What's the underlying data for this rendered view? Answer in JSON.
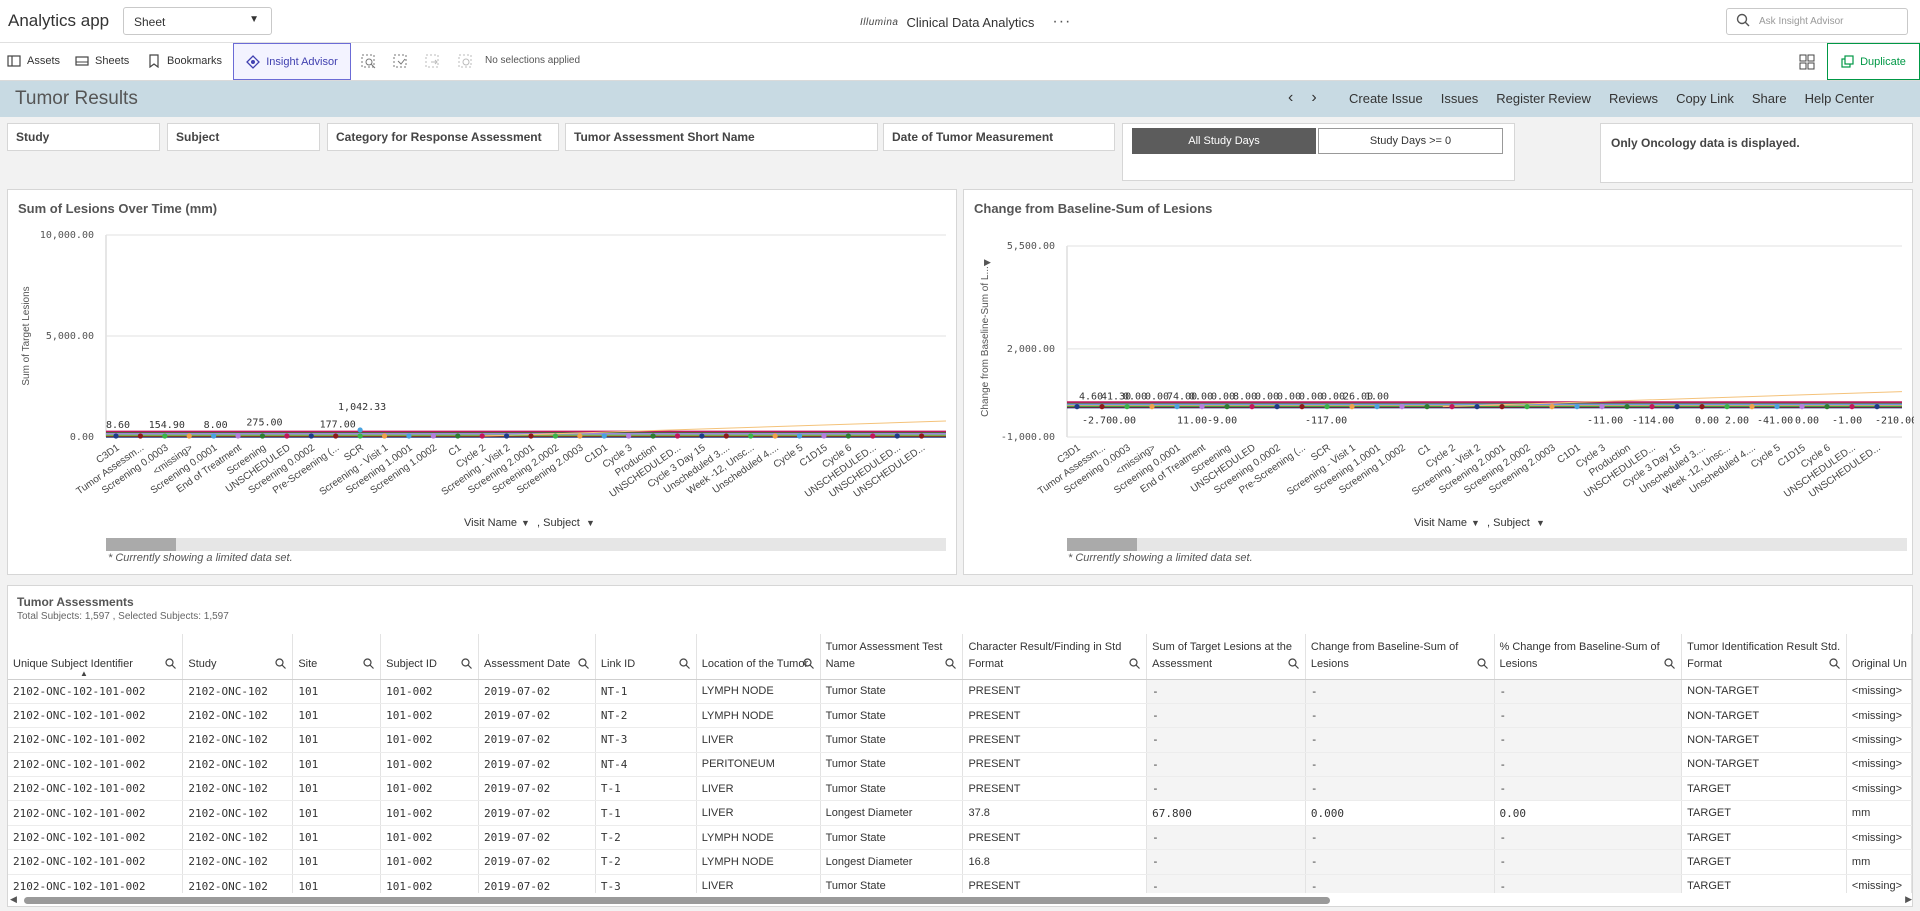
{
  "topbar": {
    "app_name": "Analytics app",
    "sheet_select": "Sheet",
    "brand_logo": "Illumina",
    "brand_title": "Clinical Data Analytics",
    "more": "···",
    "ask_placeholder": "Ask Insight Advisor"
  },
  "toolbar": {
    "assets": "Assets",
    "sheets": "Sheets",
    "bookmarks": "Bookmarks",
    "insight_advisor": "Insight Advisor",
    "no_selections": "No selections applied",
    "duplicate": "Duplicate"
  },
  "sheetbar": {
    "title": "Tumor Results",
    "prev": "‹",
    "next": "›",
    "links": [
      "Create Issue",
      "Issues",
      "Register Review",
      "Reviews",
      "Copy Link",
      "Share",
      "Help Center"
    ]
  },
  "filters": [
    "Study",
    "Subject",
    "Category for Response Assessment",
    "Tumor Assessment Short Name",
    "Date of Tumor Measurement"
  ],
  "days": {
    "all": "All Study Days",
    "ge0": "Study Days >= 0"
  },
  "note": "Only Oncology data is displayed.",
  "chart1": {
    "title": "Sum of Lesions Over Time (mm)",
    "dim1": "Visit Name",
    "dim2": ", Subject",
    "limited": "* Currently showing a limited data set."
  },
  "chart2": {
    "title": "Change from Baseline-Sum of Lesions",
    "dim1": "Visit Name",
    "dim2": ", Subject",
    "limited": "* Currently showing a limited data set."
  },
  "chart_data": [
    {
      "type": "line",
      "title": "Sum of Lesions Over Time (mm)",
      "xlabel": "Visit Name , Subject",
      "ylabel": "Sum of Target Lesions",
      "ylim": [
        0,
        10000
      ],
      "yticks": [
        "0.00",
        "5,000.00",
        "10,000.00"
      ],
      "categories": [
        "C3D1",
        "Tumor Assessm...",
        "Screening 0.0003",
        "<missing>",
        "Screening 0.0001",
        "End of Treatment",
        "Screening",
        "UNSCHEDULED",
        "Screening 0.0002",
        "Pre-Screening (...",
        "SCR",
        "Screening - Visit 1",
        "Screening 1.0001",
        "Screening 1.0002",
        "C1",
        "Cycle 2",
        "Screening - Visit 2",
        "Screening 2.0001",
        "Screening 2.0002",
        "Screening 2.0003",
        "C1D1",
        "Cycle 3",
        "Production",
        "UNSCHEDULED...",
        "Cycle 3 Day 15",
        "Unscheduled 3....",
        "Week -12, Unsc...",
        "Unscheduled 4....",
        "Cycle 5",
        "C1D15",
        "Cycle 6",
        "UNSCHEDULED...",
        "UNSCHEDULED...",
        "UNSCHEDULED..."
      ],
      "data_labels": [
        {
          "category": "C3D1",
          "value": 8.6,
          "text": "8.60"
        },
        {
          "category": "Screening 0.0003",
          "value": 154.9,
          "text": "154.90"
        },
        {
          "category": "Screening 0.0001",
          "value": 8.0,
          "text": "8.00"
        },
        {
          "category": "Screening",
          "value": 275.0,
          "text": "275.00"
        },
        {
          "category": "Pre-Screening (...",
          "value": 177.0,
          "text": "177.00"
        },
        {
          "category": "SCR",
          "value": 1042.33,
          "text": "1,042.33"
        }
      ],
      "colors": [
        "#1f3c88",
        "#8e1b1b",
        "#3cb44b",
        "#f0a14a",
        "#4aa3df",
        "#b57edc",
        "#2e7d32",
        "#c2185b"
      ],
      "scrollbar": true
    },
    {
      "type": "line",
      "title": "Change from Baseline-Sum of Lesions",
      "xlabel": "Visit Name , Subject",
      "ylabel": "Change from Baseline-Sum of L...",
      "ylim": [
        -1000,
        5500
      ],
      "yticks": [
        "-1,000.00",
        "2,000.00",
        "5,500.00"
      ],
      "categories": [
        "C3D1",
        "Tumor Assessm...",
        "Screening 0.0003",
        "<missing>",
        "Screening 0.0001",
        "End of Treatment",
        "Screening",
        "UNSCHEDULED",
        "Screening 0.0002",
        "Pre-Screening (...",
        "SCR",
        "Screening - Visit 1",
        "Screening 1.0001",
        "Screening 1.0002",
        "C1",
        "Cycle 2",
        "Screening - Visit 2",
        "Screening 2.0001",
        "Screening 2.0002",
        "Screening 2.0003",
        "C1D1",
        "Cycle 3",
        "Production",
        "UNSCHEDULED...",
        "Cycle 3 Day 15",
        "Unscheduled 3....",
        "Week -12, Unsc...",
        "Unscheduled 4....",
        "Cycle 5",
        "C1D15",
        "Cycle 6",
        "UNSCHEDULED...",
        "UNSCHEDULED..."
      ],
      "data_labels_above": [
        "4.60",
        "41.30",
        "0.00",
        "0.00",
        "74.00",
        "0.00",
        "0.00",
        "8.00",
        "0.00",
        "0.00",
        "0.00",
        "0.00",
        "26.00",
        "1.00"
      ],
      "data_labels_below": [
        "-2.70",
        "0.00",
        "11.00",
        "-9.00",
        "-117.00",
        "-11.00",
        "-114.00",
        "0.00",
        "2.00",
        "-41.00",
        "0.00",
        "-1.00",
        "-210.00"
      ],
      "scrollbar": true
    }
  ],
  "table": {
    "title": "Tumor Assessments",
    "subtitle": "Total Subjects: 1,597 , Selected Subjects: 1,597",
    "columns": [
      "Unique Subject Identifier",
      "Study",
      "Site",
      "Subject ID",
      "Assessment Date",
      "Link ID",
      "Location of the Tumor",
      "Tumor Assessment Test Name",
      "Character Result/Finding in Std Format",
      "Sum of Target Lesions at the Assessment",
      "Change from Baseline-Sum of Lesions",
      "% Change from Baseline-Sum of Lesions",
      "Tumor Identification Result Std. Format",
      "Original Un"
    ],
    "rows": [
      [
        "2102-ONC-102-101-002",
        "2102-ONC-102",
        "101",
        "101-002",
        "2019-07-02",
        "NT-1",
        "LYMPH NODE",
        "Tumor State",
        "PRESENT",
        "-",
        "-",
        "-",
        "NON-TARGET",
        "<missing>"
      ],
      [
        "2102-ONC-102-101-002",
        "2102-ONC-102",
        "101",
        "101-002",
        "2019-07-02",
        "NT-2",
        "LYMPH NODE",
        "Tumor State",
        "PRESENT",
        "-",
        "-",
        "-",
        "NON-TARGET",
        "<missing>"
      ],
      [
        "2102-ONC-102-101-002",
        "2102-ONC-102",
        "101",
        "101-002",
        "2019-07-02",
        "NT-3",
        "LIVER",
        "Tumor State",
        "PRESENT",
        "-",
        "-",
        "-",
        "NON-TARGET",
        "<missing>"
      ],
      [
        "2102-ONC-102-101-002",
        "2102-ONC-102",
        "101",
        "101-002",
        "2019-07-02",
        "NT-4",
        "PERITONEUM",
        "Tumor State",
        "PRESENT",
        "-",
        "-",
        "-",
        "NON-TARGET",
        "<missing>"
      ],
      [
        "2102-ONC-102-101-002",
        "2102-ONC-102",
        "101",
        "101-002",
        "2019-07-02",
        "T-1",
        "LIVER",
        "Tumor State",
        "PRESENT",
        "-",
        "-",
        "-",
        "TARGET",
        "<missing>"
      ],
      [
        "2102-ONC-102-101-002",
        "2102-ONC-102",
        "101",
        "101-002",
        "2019-07-02",
        "T-1",
        "LIVER",
        "Longest Diameter",
        "37.8",
        "67.800",
        "0.000",
        "0.00",
        "TARGET",
        "mm"
      ],
      [
        "2102-ONC-102-101-002",
        "2102-ONC-102",
        "101",
        "101-002",
        "2019-07-02",
        "T-2",
        "LYMPH NODE",
        "Tumor State",
        "PRESENT",
        "-",
        "-",
        "-",
        "TARGET",
        "<missing>"
      ],
      [
        "2102-ONC-102-101-002",
        "2102-ONC-102",
        "101",
        "101-002",
        "2019-07-02",
        "T-2",
        "LYMPH NODE",
        "Longest Diameter",
        "16.8",
        "-",
        "-",
        "-",
        "TARGET",
        "mm"
      ],
      [
        "2102-ONC-102-101-002",
        "2102-ONC-102",
        "101",
        "101-002",
        "2019-07-02",
        "T-3",
        "LIVER",
        "Tumor State",
        "PRESENT",
        "-",
        "-",
        "-",
        "TARGET",
        "<missing>"
      ]
    ]
  }
}
